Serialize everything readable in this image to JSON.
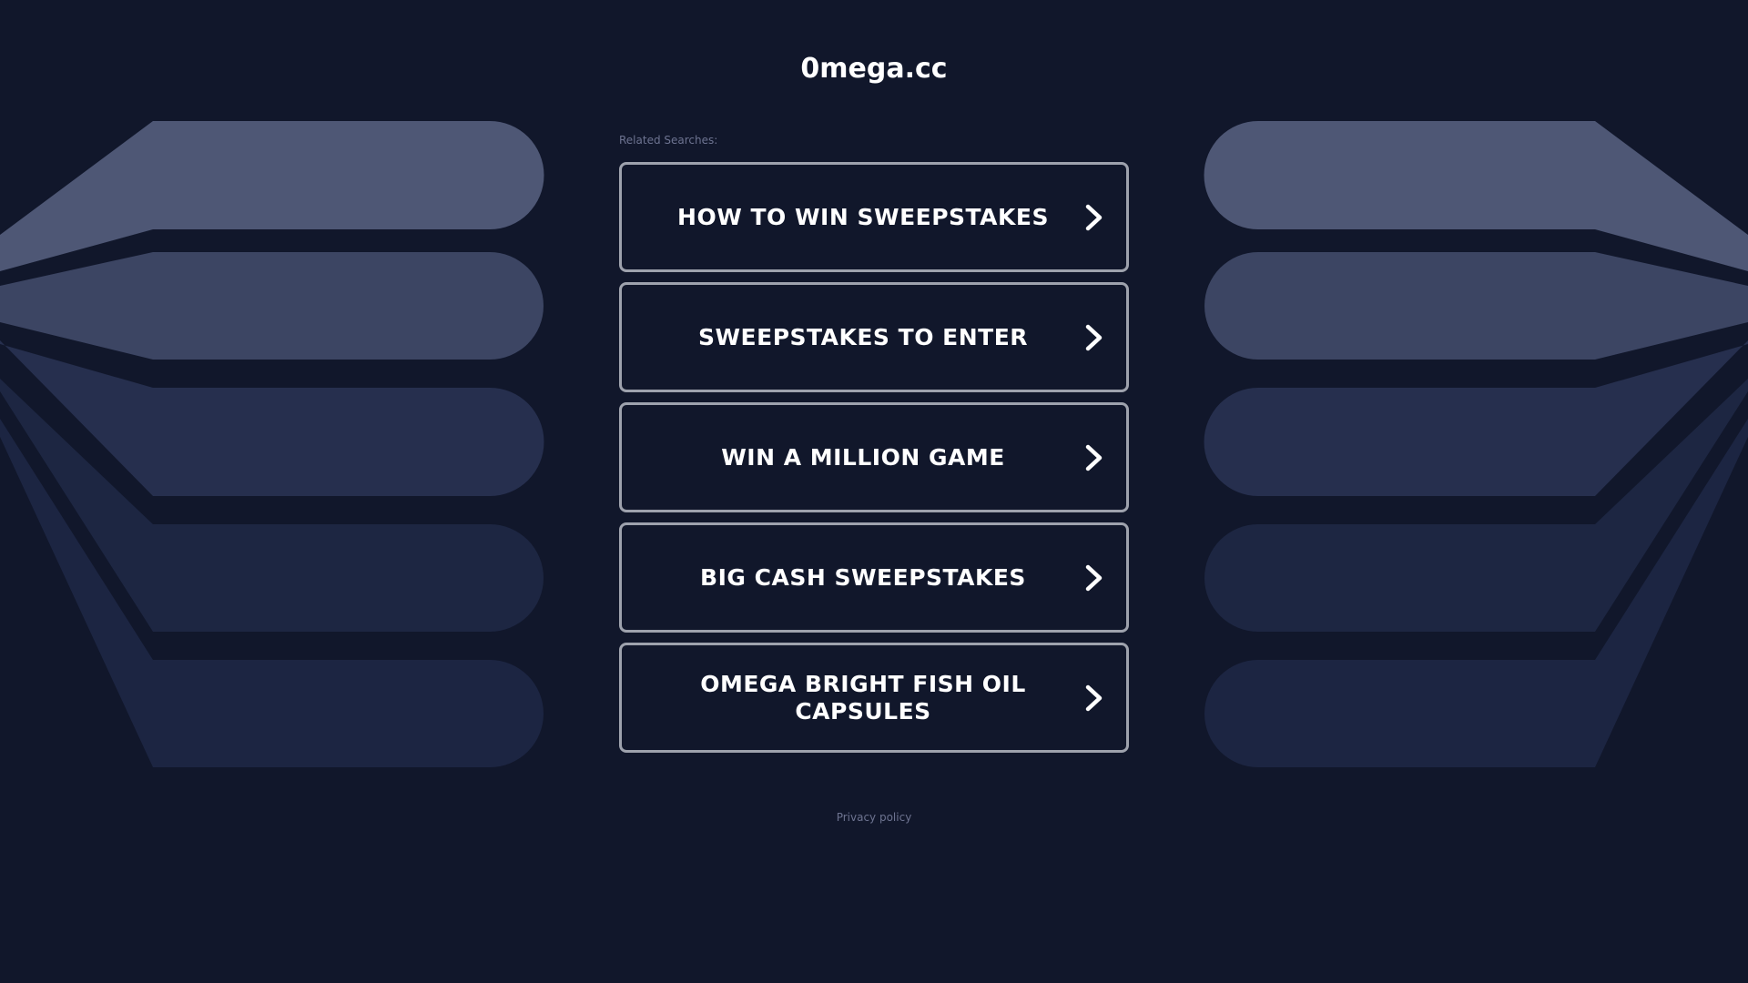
{
  "page": {
    "domain": "0mega.cc",
    "related_label": "Related Searches:",
    "links": [
      {
        "label": "HOW TO WIN SWEEPSTAKES"
      },
      {
        "label": "SWEEPSTAKES TO ENTER"
      },
      {
        "label": "WIN A MILLION GAME"
      },
      {
        "label": "BIG CASH SWEEPSTAKES"
      },
      {
        "label": "OMEGA BRIGHT FISH OIL CAPSULES"
      }
    ],
    "privacy_label": "Privacy policy",
    "arrow_icon": "chevron-right-icon"
  },
  "colors": {
    "background": "#11172b",
    "shape_1": "#4e5775",
    "shape_2": "#3c4563",
    "shape_3": "#262f4e",
    "shape_4": "#1d2642",
    "shape_5": "#1c2542",
    "button_border": "#9ea2ad",
    "muted_text": "#6d7390"
  }
}
